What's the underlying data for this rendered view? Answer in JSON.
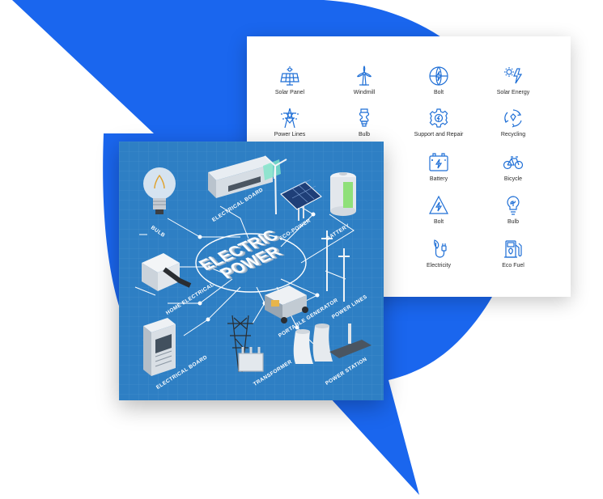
{
  "colors": {
    "brand_blue": "#1a66ee",
    "poster_blue": "#2e7fc4",
    "icon_blue": "#1f6fd6"
  },
  "icon_grid": {
    "items": [
      {
        "label": "Solar Panel",
        "icon": "solar-panel-icon"
      },
      {
        "label": "Windmill",
        "icon": "windmill-icon"
      },
      {
        "label": "Bolt",
        "icon": "bolt-globe-icon"
      },
      {
        "label": "Solar Energy",
        "icon": "solar-energy-icon"
      },
      {
        "label": "Power Lines",
        "icon": "power-lines-icon"
      },
      {
        "label": "Bulb",
        "icon": "bulb-icon"
      },
      {
        "label": "Support and Repair",
        "icon": "gear-icon"
      },
      {
        "label": "Recycling",
        "icon": "recycling-icon"
      },
      {
        "label": "Battery",
        "icon": "battery-icon"
      },
      {
        "label": "Bicycle",
        "icon": "bicycle-icon"
      },
      {
        "label": "Bolt",
        "icon": "bolt-warning-icon"
      },
      {
        "label": "Bulb",
        "icon": "eco-bulb-icon"
      },
      {
        "label": "Electricity",
        "icon": "plug-leaf-icon"
      },
      {
        "label": "Eco Fuel",
        "icon": "fuel-pump-icon"
      }
    ]
  },
  "poster": {
    "title_line1": "ELECTRIC",
    "title_line2": "POWER",
    "labels": {
      "bulb": "BULB",
      "electrical_board_top": "ELECTRICAL BOARD",
      "eco_power": "ECO-POWER",
      "battery": "BATTERY",
      "home_electrical": "HOME ELECTRICAL",
      "portable_generator": "PORTABLE GENERATOR",
      "power_lines": "POWER LINES",
      "electrical_board_bottom": "ELECTRICAL BOARD",
      "transformer": "TRANSFORMER",
      "power_station": "POWER STATION"
    }
  }
}
